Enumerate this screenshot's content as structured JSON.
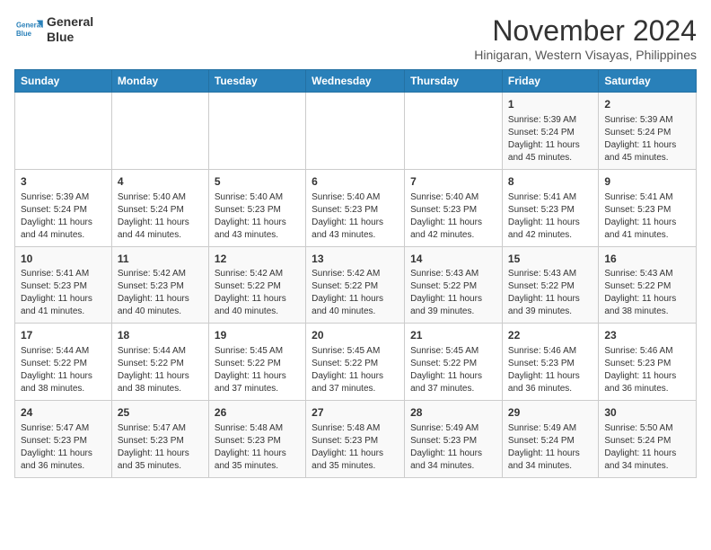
{
  "logo": {
    "line1": "General",
    "line2": "Blue"
  },
  "title": "November 2024",
  "subtitle": "Hinigaran, Western Visayas, Philippines",
  "days_of_week": [
    "Sunday",
    "Monday",
    "Tuesday",
    "Wednesday",
    "Thursday",
    "Friday",
    "Saturday"
  ],
  "weeks": [
    [
      {
        "day": "",
        "info": ""
      },
      {
        "day": "",
        "info": ""
      },
      {
        "day": "",
        "info": ""
      },
      {
        "day": "",
        "info": ""
      },
      {
        "day": "",
        "info": ""
      },
      {
        "day": "1",
        "info": "Sunrise: 5:39 AM\nSunset: 5:24 PM\nDaylight: 11 hours and 45 minutes."
      },
      {
        "day": "2",
        "info": "Sunrise: 5:39 AM\nSunset: 5:24 PM\nDaylight: 11 hours and 45 minutes."
      }
    ],
    [
      {
        "day": "3",
        "info": "Sunrise: 5:39 AM\nSunset: 5:24 PM\nDaylight: 11 hours and 44 minutes."
      },
      {
        "day": "4",
        "info": "Sunrise: 5:40 AM\nSunset: 5:24 PM\nDaylight: 11 hours and 44 minutes."
      },
      {
        "day": "5",
        "info": "Sunrise: 5:40 AM\nSunset: 5:23 PM\nDaylight: 11 hours and 43 minutes."
      },
      {
        "day": "6",
        "info": "Sunrise: 5:40 AM\nSunset: 5:23 PM\nDaylight: 11 hours and 43 minutes."
      },
      {
        "day": "7",
        "info": "Sunrise: 5:40 AM\nSunset: 5:23 PM\nDaylight: 11 hours and 42 minutes."
      },
      {
        "day": "8",
        "info": "Sunrise: 5:41 AM\nSunset: 5:23 PM\nDaylight: 11 hours and 42 minutes."
      },
      {
        "day": "9",
        "info": "Sunrise: 5:41 AM\nSunset: 5:23 PM\nDaylight: 11 hours and 41 minutes."
      }
    ],
    [
      {
        "day": "10",
        "info": "Sunrise: 5:41 AM\nSunset: 5:23 PM\nDaylight: 11 hours and 41 minutes."
      },
      {
        "day": "11",
        "info": "Sunrise: 5:42 AM\nSunset: 5:23 PM\nDaylight: 11 hours and 40 minutes."
      },
      {
        "day": "12",
        "info": "Sunrise: 5:42 AM\nSunset: 5:22 PM\nDaylight: 11 hours and 40 minutes."
      },
      {
        "day": "13",
        "info": "Sunrise: 5:42 AM\nSunset: 5:22 PM\nDaylight: 11 hours and 40 minutes."
      },
      {
        "day": "14",
        "info": "Sunrise: 5:43 AM\nSunset: 5:22 PM\nDaylight: 11 hours and 39 minutes."
      },
      {
        "day": "15",
        "info": "Sunrise: 5:43 AM\nSunset: 5:22 PM\nDaylight: 11 hours and 39 minutes."
      },
      {
        "day": "16",
        "info": "Sunrise: 5:43 AM\nSunset: 5:22 PM\nDaylight: 11 hours and 38 minutes."
      }
    ],
    [
      {
        "day": "17",
        "info": "Sunrise: 5:44 AM\nSunset: 5:22 PM\nDaylight: 11 hours and 38 minutes."
      },
      {
        "day": "18",
        "info": "Sunrise: 5:44 AM\nSunset: 5:22 PM\nDaylight: 11 hours and 38 minutes."
      },
      {
        "day": "19",
        "info": "Sunrise: 5:45 AM\nSunset: 5:22 PM\nDaylight: 11 hours and 37 minutes."
      },
      {
        "day": "20",
        "info": "Sunrise: 5:45 AM\nSunset: 5:22 PM\nDaylight: 11 hours and 37 minutes."
      },
      {
        "day": "21",
        "info": "Sunrise: 5:45 AM\nSunset: 5:22 PM\nDaylight: 11 hours and 37 minutes."
      },
      {
        "day": "22",
        "info": "Sunrise: 5:46 AM\nSunset: 5:23 PM\nDaylight: 11 hours and 36 minutes."
      },
      {
        "day": "23",
        "info": "Sunrise: 5:46 AM\nSunset: 5:23 PM\nDaylight: 11 hours and 36 minutes."
      }
    ],
    [
      {
        "day": "24",
        "info": "Sunrise: 5:47 AM\nSunset: 5:23 PM\nDaylight: 11 hours and 36 minutes."
      },
      {
        "day": "25",
        "info": "Sunrise: 5:47 AM\nSunset: 5:23 PM\nDaylight: 11 hours and 35 minutes."
      },
      {
        "day": "26",
        "info": "Sunrise: 5:48 AM\nSunset: 5:23 PM\nDaylight: 11 hours and 35 minutes."
      },
      {
        "day": "27",
        "info": "Sunrise: 5:48 AM\nSunset: 5:23 PM\nDaylight: 11 hours and 35 minutes."
      },
      {
        "day": "28",
        "info": "Sunrise: 5:49 AM\nSunset: 5:23 PM\nDaylight: 11 hours and 34 minutes."
      },
      {
        "day": "29",
        "info": "Sunrise: 5:49 AM\nSunset: 5:24 PM\nDaylight: 11 hours and 34 minutes."
      },
      {
        "day": "30",
        "info": "Sunrise: 5:50 AM\nSunset: 5:24 PM\nDaylight: 11 hours and 34 minutes."
      }
    ]
  ]
}
